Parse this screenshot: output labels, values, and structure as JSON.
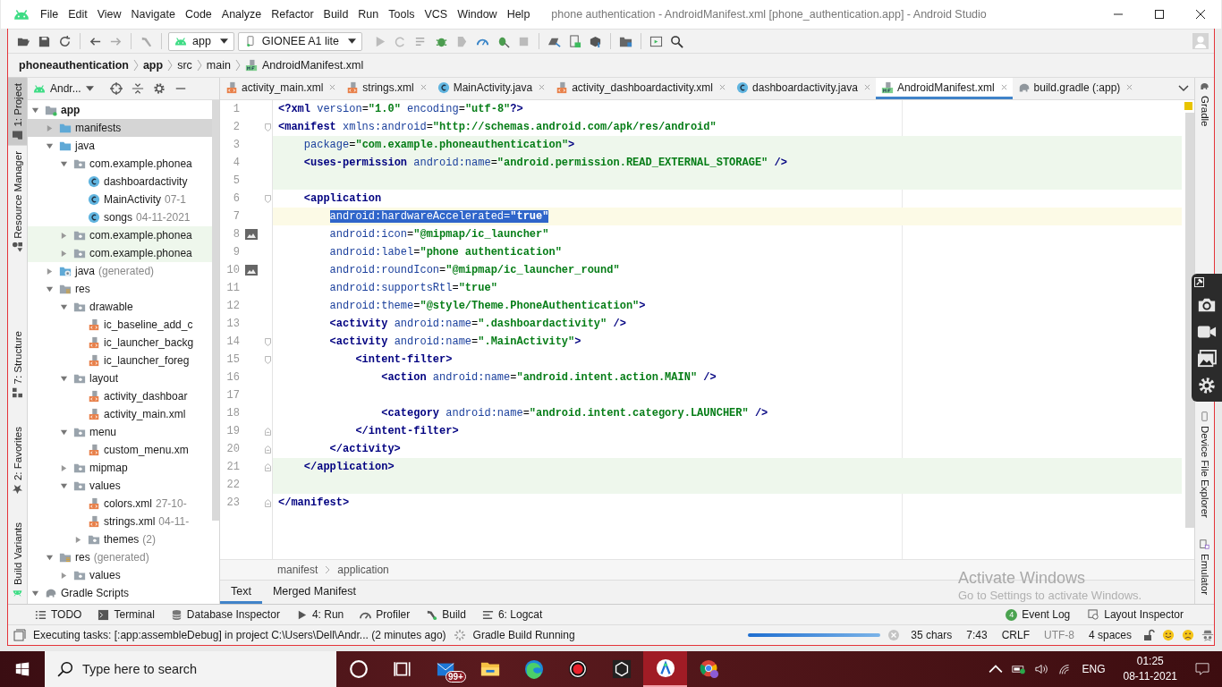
{
  "window": {
    "title": "phone authentication - AndroidManifest.xml [phone_authentication.app] - Android Studio"
  },
  "menu": [
    "File",
    "Edit",
    "View",
    "Navigate",
    "Code",
    "Analyze",
    "Refactor",
    "Build",
    "Run",
    "Tools",
    "VCS",
    "Window",
    "Help"
  ],
  "toolbar": {
    "run_config": "app",
    "device": "GIONEE A1 lite"
  },
  "breadcrumb": [
    {
      "label": "phoneauthentication",
      "bold": true
    },
    {
      "label": "app",
      "bold": true
    },
    {
      "label": "src",
      "bold": false
    },
    {
      "label": "main",
      "bold": false
    },
    {
      "label": "AndroidManifest.xml",
      "bold": false
    }
  ],
  "left_strip": [
    {
      "label": "1: Project",
      "selected": true
    },
    {
      "label": "Resource Manager",
      "selected": false
    },
    {
      "label": "7: Structure",
      "selected": false
    },
    {
      "label": "2: Favorites",
      "selected": false
    },
    {
      "label": "Build Variants",
      "selected": false
    }
  ],
  "project_panel": {
    "view": "Andr...",
    "tree": [
      {
        "label": "app",
        "kind": "module",
        "expanded": true,
        "selected": false,
        "highlighted": false,
        "children": [
          {
            "label": "manifests",
            "kind": "folder-blue",
            "expanded": false,
            "selected": true,
            "highlighted": false
          },
          {
            "label": "java",
            "kind": "folder-blue",
            "expanded": true,
            "selected": false,
            "highlighted": false,
            "children": [
              {
                "label": "com.example.phonea",
                "kind": "package",
                "expanded": true,
                "selected": false,
                "highlighted": false,
                "children": [
                  {
                    "label": "dashboardactivity",
                    "kind": "class",
                    "selected": false,
                    "highlighted": false
                  },
                  {
                    "label": "MainActivity",
                    "detail": "07-1",
                    "kind": "class",
                    "selected": false,
                    "highlighted": false
                  },
                  {
                    "label": "songs",
                    "detail": "04-11-2021",
                    "kind": "class",
                    "selected": false,
                    "highlighted": false
                  }
                ]
              },
              {
                "label": "com.example.phonea",
                "kind": "package",
                "expanded": false,
                "selected": false,
                "highlighted": true
              },
              {
                "label": "com.example.phonea",
                "kind": "package",
                "expanded": false,
                "selected": false,
                "highlighted": true
              }
            ]
          },
          {
            "label": "java",
            "detail": "(generated)",
            "kind": "java-gen",
            "expanded": false,
            "selected": false,
            "highlighted": false
          },
          {
            "label": "res",
            "kind": "res",
            "expanded": true,
            "selected": false,
            "highlighted": false,
            "children": [
              {
                "label": "drawable",
                "kind": "package",
                "expanded": true,
                "selected": false,
                "highlighted": false,
                "children": [
                  {
                    "label": "ic_baseline_add_c",
                    "kind": "xml",
                    "selected": false,
                    "highlighted": false
                  },
                  {
                    "label": "ic_launcher_backg",
                    "kind": "xml",
                    "selected": false,
                    "highlighted": false
                  },
                  {
                    "label": "ic_launcher_foreg",
                    "kind": "xml",
                    "selected": false,
                    "highlighted": false
                  }
                ]
              },
              {
                "label": "layout",
                "kind": "package",
                "expanded": true,
                "selected": false,
                "highlighted": false,
                "children": [
                  {
                    "label": "activity_dashboar",
                    "kind": "xml",
                    "selected": false,
                    "highlighted": false
                  },
                  {
                    "label": "activity_main.xml",
                    "kind": "xml",
                    "selected": false,
                    "highlighted": false
                  }
                ]
              },
              {
                "label": "menu",
                "kind": "package",
                "expanded": true,
                "selected": false,
                "highlighted": false,
                "children": [
                  {
                    "label": "custom_menu.xm",
                    "kind": "xml",
                    "selected": false,
                    "highlighted": false
                  }
                ]
              },
              {
                "label": "mipmap",
                "kind": "package",
                "expanded": false,
                "selected": false,
                "highlighted": false
              },
              {
                "label": "values",
                "kind": "package",
                "expanded": true,
                "selected": false,
                "highlighted": false,
                "children": [
                  {
                    "label": "colors.xml",
                    "detail": "27-10-",
                    "kind": "xml",
                    "selected": false,
                    "highlighted": false
                  },
                  {
                    "label": "strings.xml",
                    "detail": "04-11-",
                    "kind": "xml",
                    "selected": false,
                    "highlighted": false
                  },
                  {
                    "label": "themes",
                    "detail": "(2)",
                    "kind": "package",
                    "expanded": false,
                    "selected": false,
                    "highlighted": false
                  }
                ]
              }
            ]
          },
          {
            "label": "res",
            "detail": "(generated)",
            "kind": "res",
            "expanded": true,
            "selected": false,
            "highlighted": false,
            "children": [
              {
                "label": "values",
                "kind": "package",
                "expanded": false,
                "selected": false,
                "highlighted": false
              }
            ]
          }
        ]
      },
      {
        "label": "Gradle Scripts",
        "kind": "gradle",
        "expanded": true,
        "selected": false,
        "highlighted": false
      }
    ]
  },
  "editor_tabs": [
    {
      "label": "activity_main.xml",
      "kind": "xml",
      "selected": false
    },
    {
      "label": "strings.xml",
      "kind": "xml",
      "selected": false
    },
    {
      "label": "MainActivity.java",
      "kind": "class",
      "selected": false
    },
    {
      "label": "activity_dashboardactivity.xml",
      "kind": "xml",
      "selected": false
    },
    {
      "label": "dashboardactivity.java",
      "kind": "class",
      "selected": false
    },
    {
      "label": "AndroidManifest.xml",
      "kind": "manifest",
      "selected": true
    },
    {
      "label": "build.gradle (:app)",
      "kind": "gradle",
      "selected": false
    }
  ],
  "code_lines": [
    {
      "number": "1",
      "kind": "plain",
      "changed": false,
      "current": false,
      "selected": false,
      "tokens": [
        {
          "t": "<?xml ",
          "kind": "tag"
        },
        {
          "t": "version",
          "kind": "attr"
        },
        {
          "t": "=",
          "kind": "punct"
        },
        {
          "t": "\"1.0\" ",
          "kind": "val"
        },
        {
          "t": "encoding",
          "kind": "attr"
        },
        {
          "t": "=",
          "kind": "punct"
        },
        {
          "t": "\"utf-8\"",
          "kind": "val"
        },
        {
          "t": "?>",
          "kind": "tag"
        }
      ]
    },
    {
      "number": "2",
      "kind": "fold-start",
      "changed": false,
      "current": false,
      "selected": false,
      "tokens": [
        {
          "t": "<manifest ",
          "kind": "tag"
        },
        {
          "t": "xmlns:android",
          "kind": "attr"
        },
        {
          "t": "=",
          "kind": "punct"
        },
        {
          "t": "\"http://schemas.android.com/apk/res/android\"",
          "kind": "val"
        }
      ]
    },
    {
      "number": "3",
      "kind": "plain",
      "changed": true,
      "current": false,
      "selected": false,
      "tokens": [
        {
          "t": "    package",
          "kind": "attr"
        },
        {
          "t": "=",
          "kind": "punct"
        },
        {
          "t": "\"com.example.phoneauthentication\"",
          "kind": "val"
        },
        {
          "t": ">",
          "kind": "tag"
        }
      ]
    },
    {
      "number": "4",
      "kind": "plain",
      "changed": true,
      "current": false,
      "selected": false,
      "tokens": [
        {
          "t": "    <uses-permission ",
          "kind": "tag"
        },
        {
          "t": "android:name",
          "kind": "attr"
        },
        {
          "t": "=",
          "kind": "punct"
        },
        {
          "t": "\"android.permission.READ_EXTERNAL_STORAGE\"",
          "kind": "val"
        },
        {
          "t": " />",
          "kind": "tag"
        }
      ]
    },
    {
      "number": "5",
      "kind": "plain",
      "changed": true,
      "current": false
    },
    {
      "number": "6",
      "kind": "fold-start",
      "changed": false,
      "current": false,
      "selected": false,
      "tokens": [
        {
          "t": "    <application",
          "kind": "tag"
        }
      ]
    },
    {
      "number": "7",
      "kind": "plain",
      "changed": false,
      "current": true,
      "selected": true,
      "tokens": [
        {
          "t": "        android:hardwareAccelerated",
          "kind": "attr"
        },
        {
          "t": "=",
          "kind": "punct"
        },
        {
          "t": "\"true\"",
          "kind": "val"
        }
      ]
    },
    {
      "number": "8",
      "kind": "image",
      "changed": false,
      "current": false,
      "selected": false,
      "tokens": [
        {
          "t": "        android:icon",
          "kind": "attr"
        },
        {
          "t": "=",
          "kind": "punct"
        },
        {
          "t": "\"@mipmap/ic_launcher\"",
          "kind": "val"
        }
      ]
    },
    {
      "number": "9",
      "kind": "plain",
      "changed": false,
      "current": false,
      "selected": false,
      "tokens": [
        {
          "t": "        android:label",
          "kind": "attr"
        },
        {
          "t": "=",
          "kind": "punct"
        },
        {
          "t": "\"phone authentication\"",
          "kind": "val"
        }
      ]
    },
    {
      "number": "10",
      "kind": "image",
      "changed": false,
      "current": false,
      "selected": false,
      "tokens": [
        {
          "t": "        android:roundIcon",
          "kind": "attr"
        },
        {
          "t": "=",
          "kind": "punct"
        },
        {
          "t": "\"@mipmap/ic_launcher_round\"",
          "kind": "val"
        }
      ]
    },
    {
      "number": "11",
      "kind": "plain",
      "changed": false,
      "current": false,
      "selected": false,
      "tokens": [
        {
          "t": "        android:supportsRtl",
          "kind": "attr"
        },
        {
          "t": "=",
          "kind": "punct"
        },
        {
          "t": "\"true\"",
          "kind": "val"
        }
      ]
    },
    {
      "number": "12",
      "kind": "plain",
      "changed": false,
      "current": false,
      "selected": false,
      "tokens": [
        {
          "t": "        android:theme",
          "kind": "attr"
        },
        {
          "t": "=",
          "kind": "punct"
        },
        {
          "t": "\"@style/Theme.PhoneAuthentication\"",
          "kind": "val"
        },
        {
          "t": ">",
          "kind": "tag"
        }
      ]
    },
    {
      "number": "13",
      "kind": "plain",
      "changed": false,
      "current": false,
      "selected": false,
      "tokens": [
        {
          "t": "        <activity ",
          "kind": "tag"
        },
        {
          "t": "android:name",
          "kind": "attr"
        },
        {
          "t": "=",
          "kind": "punct"
        },
        {
          "t": "\".dashboardactivity\"",
          "kind": "val"
        },
        {
          "t": " />",
          "kind": "tag"
        }
      ]
    },
    {
      "number": "14",
      "kind": "fold-start",
      "changed": false,
      "current": false,
      "selected": false,
      "tokens": [
        {
          "t": "        <activity ",
          "kind": "tag"
        },
        {
          "t": "android:name",
          "kind": "attr"
        },
        {
          "t": "=",
          "kind": "punct"
        },
        {
          "t": "\".MainActivity\"",
          "kind": "val"
        },
        {
          "t": ">",
          "kind": "tag"
        }
      ]
    },
    {
      "number": "15",
      "kind": "fold-start",
      "changed": false,
      "current": false,
      "selected": false,
      "tokens": [
        {
          "t": "            <intent-filter>",
          "kind": "tag"
        }
      ]
    },
    {
      "number": "16",
      "kind": "plain",
      "changed": false,
      "current": false,
      "selected": false,
      "tokens": [
        {
          "t": "                <action ",
          "kind": "tag"
        },
        {
          "t": "android:name",
          "kind": "attr"
        },
        {
          "t": "=",
          "kind": "punct"
        },
        {
          "t": "\"android.intent.action.MAIN\"",
          "kind": "val"
        },
        {
          "t": " />",
          "kind": "tag"
        }
      ]
    },
    {
      "number": "17",
      "kind": "plain",
      "changed": false,
      "current": false
    },
    {
      "number": "18",
      "kind": "plain",
      "changed": false,
      "current": false,
      "selected": false,
      "tokens": [
        {
          "t": "                <category ",
          "kind": "tag"
        },
        {
          "t": "android:name",
          "kind": "attr"
        },
        {
          "t": "=",
          "kind": "punct"
        },
        {
          "t": "\"android.intent.category.LAUNCHER\"",
          "kind": "val"
        },
        {
          "t": " />",
          "kind": "tag"
        }
      ]
    },
    {
      "number": "19",
      "kind": "fold-end",
      "changed": false,
      "current": false,
      "selected": false,
      "tokens": [
        {
          "t": "            </intent-filter>",
          "kind": "tag"
        }
      ]
    },
    {
      "number": "20",
      "kind": "fold-end",
      "changed": false,
      "current": false,
      "selected": false,
      "tokens": [
        {
          "t": "        </activity>",
          "kind": "tag"
        }
      ]
    },
    {
      "number": "21",
      "kind": "fold-end",
      "changed": true,
      "current": false,
      "selected": false,
      "tokens": [
        {
          "t": "    </application>",
          "kind": "tag"
        }
      ]
    },
    {
      "number": "22",
      "kind": "plain",
      "changed": true,
      "current": false
    },
    {
      "number": "23",
      "kind": "fold-end",
      "changed": false,
      "current": false,
      "selected": false,
      "tokens": [
        {
          "t": "</manifest>",
          "kind": "tag"
        }
      ]
    }
  ],
  "right_strip": [
    "Gradle",
    "Device File Explorer",
    "Emulator"
  ],
  "editor_path": [
    "manifest",
    "application"
  ],
  "view_tabs": [
    {
      "label": "Text",
      "selected": true
    },
    {
      "label": "Merged Manifest",
      "selected": false
    }
  ],
  "tool_windows": [
    {
      "label": "TODO",
      "kind": "list"
    },
    {
      "label": "Terminal",
      "kind": "terminal"
    },
    {
      "label": "Database Inspector",
      "kind": "database"
    },
    {
      "label": "4: Run",
      "kind": "play"
    },
    {
      "label": "Profiler",
      "kind": "gauge"
    },
    {
      "label": "Build",
      "kind": "hammer"
    },
    {
      "label": "6: Logcat",
      "kind": "lines"
    }
  ],
  "tool_windows_right": [
    {
      "label": "Event Log",
      "badge": "4"
    },
    {
      "label": "Layout Inspector"
    }
  ],
  "activation_notice": {
    "title": "Activate Windows",
    "text": "Go to Settings to activate Windows."
  },
  "status_bar": {
    "message": "Executing tasks: [:app:assembleDebug] in project C:\\Users\\Dell\\Andr... (2 minutes ago)",
    "task": "Gradle Build Running",
    "level": 1,
    "items": [
      "35 chars",
      "7:43",
      "CRLF",
      "UTF-8",
      "4 spaces"
    ]
  },
  "taskbar": {
    "search_placeholder": "Type here to search",
    "apps": [
      {
        "kind": "cortana",
        "selected": false
      },
      {
        "kind": "taskview",
        "selected": false
      },
      {
        "kind": "mail",
        "badge": "99+",
        "selected": false
      },
      {
        "kind": "explorer",
        "selected": false
      },
      {
        "kind": "edge",
        "selected": false
      },
      {
        "kind": "record",
        "selected": false
      },
      {
        "kind": "unity",
        "selected": false
      },
      {
        "kind": "studio",
        "selected": true
      },
      {
        "kind": "chrome",
        "selected": false
      }
    ],
    "language": "ENG",
    "time": "01:25",
    "date": "08-11-2021"
  }
}
